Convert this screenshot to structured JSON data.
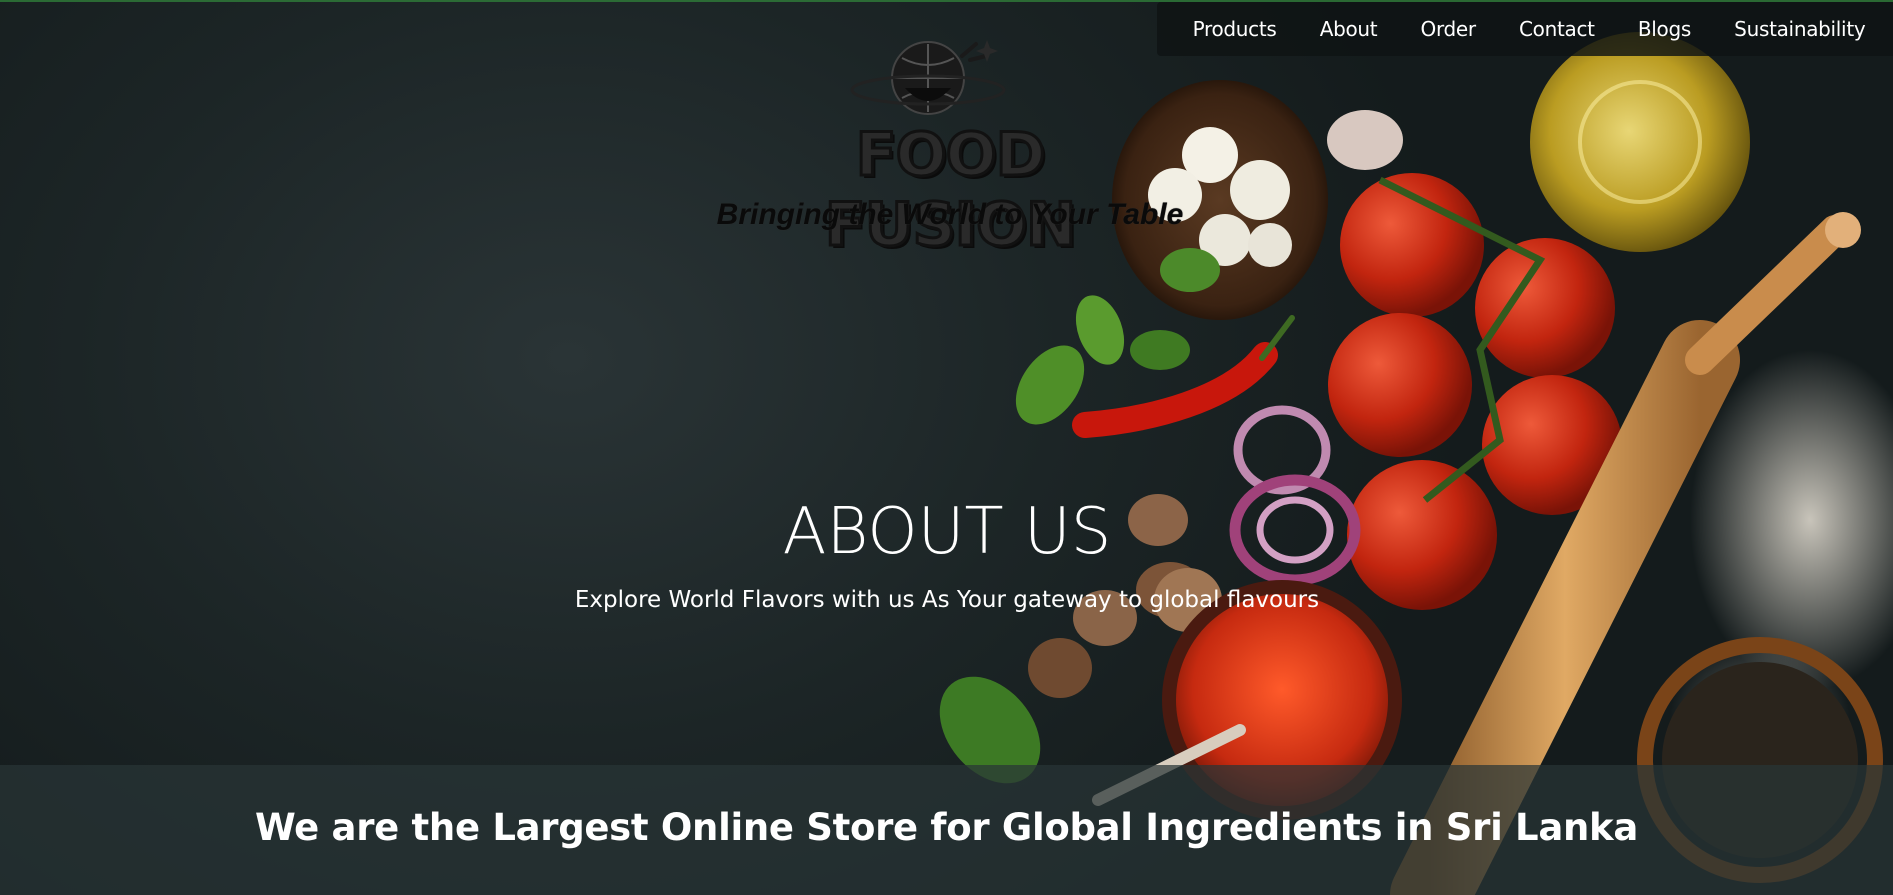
{
  "nav": {
    "items": [
      "Products",
      "About",
      "Order",
      "Contact",
      "Blogs",
      "Sustainability"
    ]
  },
  "logo": {
    "title": "FOOD FUSION",
    "tagline": "Bringing the World to Your Table"
  },
  "hero": {
    "title": "ABOUT US",
    "subtitle": "Explore World Flavors with us As Your gateway to global flavours"
  },
  "banner": {
    "text": "We are the Largest Online Store for Global Ingredients in Sri Lanka"
  },
  "colors": {
    "background": "#1b2324",
    "nav_bg": "#0f1414",
    "text": "#ffffff",
    "tomato": "#c52a14"
  }
}
